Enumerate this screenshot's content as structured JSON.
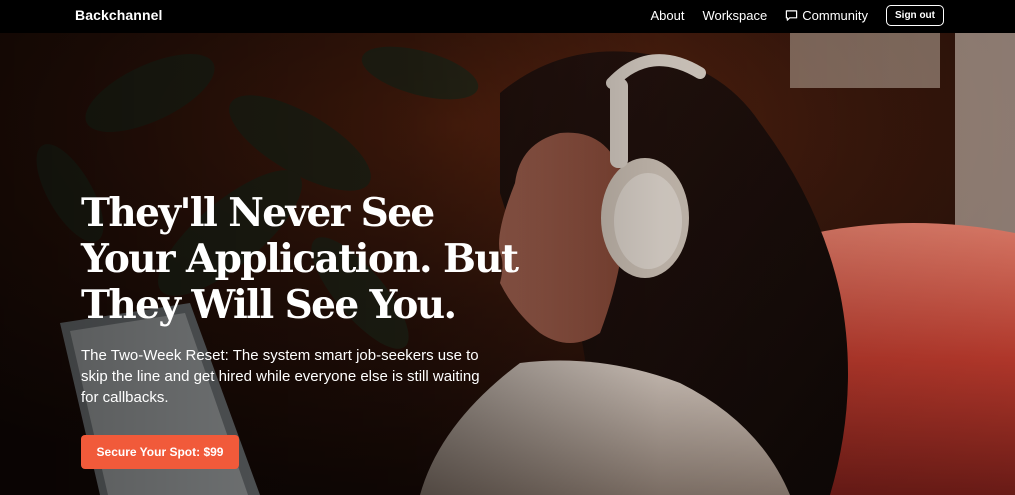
{
  "brand": {
    "name": "Backchannel"
  },
  "nav": {
    "about": "About",
    "workspace": "Workspace",
    "community": "Community",
    "sign_out": "Sign out"
  },
  "hero": {
    "title": "They'll Never See Your Application. But They Will See You.",
    "subtitle": "The Two-Week Reset: The system smart job-seekers use to skip the line and get hired while everyone else is still waiting for callbacks.",
    "cta": "Secure Your Spot: $99"
  },
  "colors": {
    "nav_bg": "#000000",
    "cta_bg": "#f15a3a",
    "text": "#ffffff"
  },
  "icons": [
    "chat-bubble-icon"
  ]
}
